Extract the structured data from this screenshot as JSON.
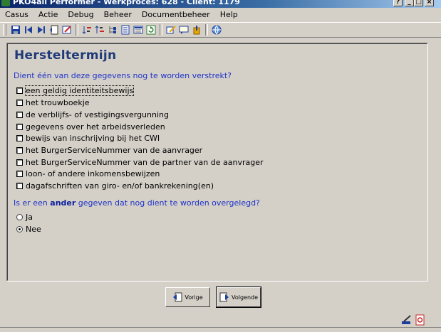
{
  "window": {
    "title": "PKO4all Performer - Werkproces: 628 - Client: 1179",
    "buttons": [
      "?",
      "_",
      "□",
      "×"
    ]
  },
  "menu": [
    "Casus",
    "Actie",
    "Debug",
    "Beheer",
    "Documentbeheer",
    "Help"
  ],
  "page": {
    "title": "Hersteltermijn",
    "question1": "Dient één van deze gegevens nog te worden verstrekt?",
    "checkboxes": [
      {
        "label": "een geldig identiteitsbewijs",
        "checked": false
      },
      {
        "label": "het trouwboekje",
        "checked": false
      },
      {
        "label": "de verblijfs- of vestigingsvergunning",
        "checked": false
      },
      {
        "label": "gegevens over het arbeidsverleden",
        "checked": false
      },
      {
        "label": "bewijs van inschrijving bij het CWI",
        "checked": false
      },
      {
        "label": "het BurgerServiceNummer van de aanvrager",
        "checked": false
      },
      {
        "label": "het BurgerServiceNummer van de partner van de aanvrager",
        "checked": false
      },
      {
        "label": "loon- of andere inkomensbewijzen",
        "checked": false
      },
      {
        "label": "dagafschriften van giro- en/of bankrekening(en)",
        "checked": false
      }
    ],
    "question2_pre": "Is er een ",
    "question2_bold": "ander",
    "question2_post": " gegeven dat nog dient te worden overgelegd?",
    "radios": [
      {
        "label": "Ja",
        "checked": false
      },
      {
        "label": "Nee",
        "checked": true
      }
    ]
  },
  "nav": {
    "previous_label": "Vorige",
    "next_label": "Volgende"
  }
}
